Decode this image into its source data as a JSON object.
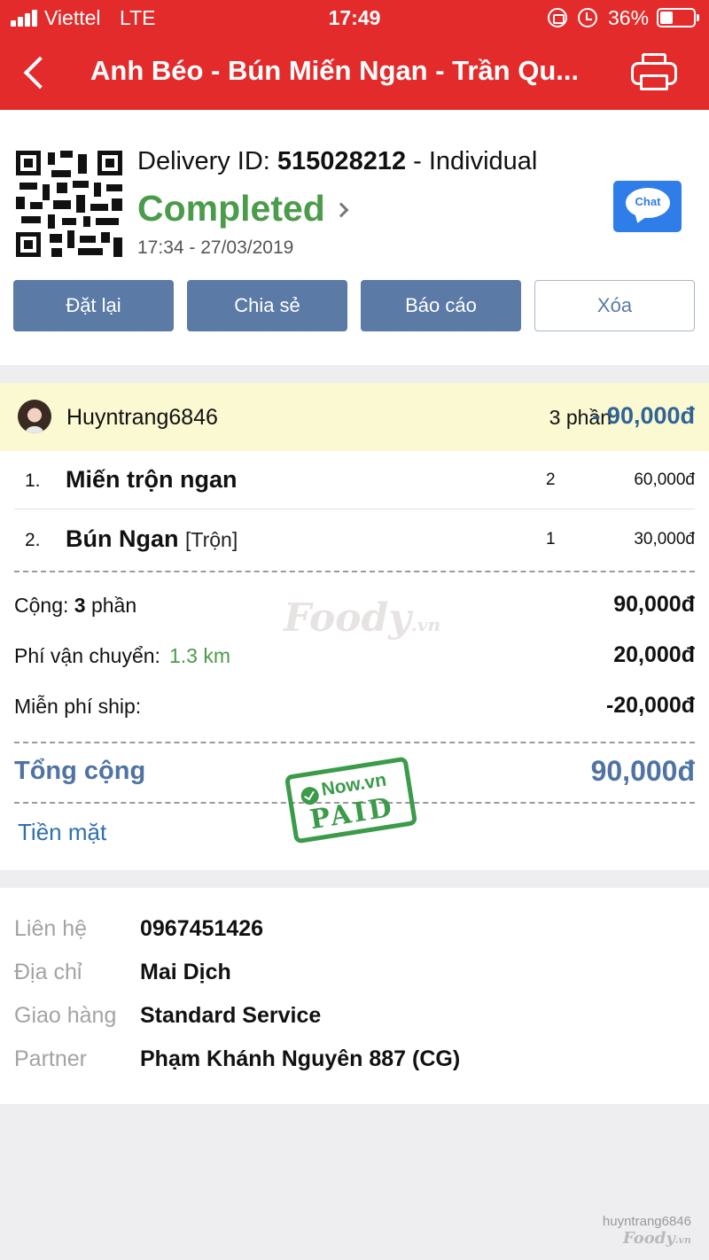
{
  "status_bar": {
    "carrier": "Viettel",
    "network": "LTE",
    "time": "17:49",
    "battery": "36%"
  },
  "header": {
    "title": "Anh Béo - Bún Miến Ngan - Trần Qu...",
    "icons": [
      "back-icon",
      "printer-icon"
    ],
    "color": "#e32b2b"
  },
  "order": {
    "delivery_id_label": "Delivery ID: ",
    "delivery_id": "515028212",
    "delivery_type": " - Individual",
    "status": "Completed",
    "datetime": "17:34 - 27/03/2019",
    "chat_label": "Chat",
    "status_color": "#4a9b4a"
  },
  "actions": {
    "reorder": "Đặt lại",
    "share": "Chia sẻ",
    "report": "Báo cáo",
    "delete": "Xóa"
  },
  "user": {
    "name": "Huyntrang6846",
    "qty": "3 phần",
    "dash": "- ",
    "total": "90,000đ"
  },
  "items": [
    {
      "num": "1.",
      "name": "Miến trộn ngan",
      "option": "",
      "qty": "2",
      "price": "60,000đ"
    },
    {
      "num": "2.",
      "name": "Bún Ngan",
      "option": "[Trộn]",
      "qty": "1",
      "price": "30,000đ"
    }
  ],
  "summary": {
    "subtotal_label": "Cộng: ",
    "subtotal_count": "3",
    "subtotal_unit": " phần",
    "subtotal": "90,000đ",
    "shipping_label": "Phí vận chuyển:",
    "distance": "1.3 km",
    "shipping": "20,000đ",
    "free_ship_label": "Miễn phí ship:",
    "free_ship": "-20,000đ",
    "total_label": "Tổng cộng",
    "total": "90,000đ",
    "payment_method": "Tiền mặt"
  },
  "watermark": {
    "brand": "Foody",
    "suffix": ".vn"
  },
  "stamp": {
    "brand": "Now.vn",
    "text": "PAID"
  },
  "contact": {
    "rows": [
      {
        "key": "Liên hệ",
        "value": "0967451426"
      },
      {
        "key": "Địa chỉ",
        "value": "Mai Dịch"
      },
      {
        "key": "Giao hàng",
        "value": "Standard Service"
      },
      {
        "key": "Partner",
        "value": "Phạm Khánh Nguyên 887 (CG)"
      }
    ]
  },
  "photo_watermark": {
    "user": "huyntrang6846",
    "brand": "Foody",
    "suffix": ".vn"
  }
}
